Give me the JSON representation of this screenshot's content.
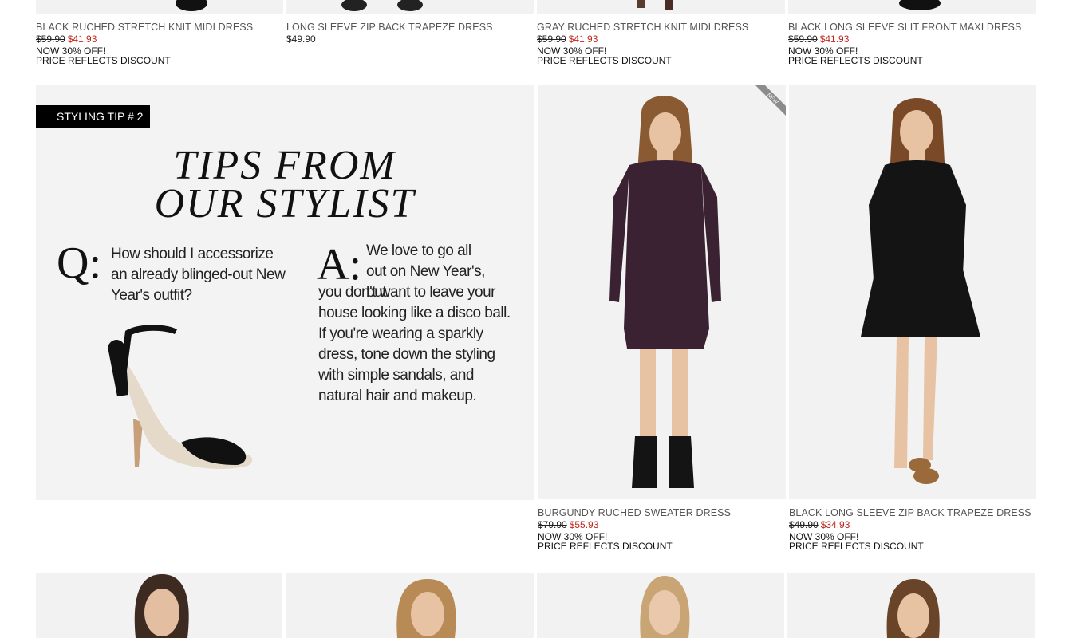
{
  "top_row": [
    {
      "name": "BLACK RUCHED STRETCH KNIT MIDI DRESS",
      "old_price": "$59.90",
      "new_price": "$41.93",
      "promo1": "NOW 30% OFF!",
      "promo2": "PRICE REFLECTS DISCOUNT"
    },
    {
      "name": "LONG SLEEVE ZIP BACK TRAPEZE DRESS",
      "price": "$49.90"
    },
    {
      "name": "GRAY RUCHED STRETCH KNIT MIDI DRESS",
      "old_price": "$59.90",
      "new_price": "$41.93",
      "promo1": "NOW 30% OFF!",
      "promo2": "PRICE REFLECTS DISCOUNT"
    },
    {
      "name": "BLACK LONG SLEEVE SLIT FRONT MAXI DRESS",
      "old_price": "$59.90",
      "new_price": "$41.93",
      "promo1": "NOW 30% OFF!",
      "promo2": "PRICE REFLECTS DISCOUNT"
    }
  ],
  "tip": {
    "label": "STYLING TIP # 2",
    "title_line1": "TIPS FROM",
    "title_line2": "OUR STYLIST",
    "q_mark": "Q:",
    "question": "How should I accessorize an already blinged-out New Year's outfit?",
    "a_mark": "A:",
    "answer_lead": "We love to go all out on New Year's, but",
    "answer_rest": "you don't want to leave your house looking like a disco ball. If you're wearing a sparkly dress, tone down the styling with simple sandals, and natural hair and makeup."
  },
  "middle_row": [
    {
      "badge": "NEW",
      "name": "BURGUNDY RUCHED SWEATER DRESS",
      "old_price": "$79.90",
      "new_price": "$55.93",
      "promo1": "NOW 30% OFF!",
      "promo2": "PRICE REFLECTS DISCOUNT"
    },
    {
      "name": "BLACK LONG SLEEVE ZIP BACK TRAPEZE DRESS",
      "old_price": "$49.90",
      "new_price": "$34.93",
      "promo1": "NOW 30% OFF!",
      "promo2": "PRICE REFLECTS DISCOUNT"
    }
  ],
  "colors": {
    "sale_red": "#c0281e",
    "image_bg": "#f2f2f2",
    "burgundy_dress": "#3a2233",
    "black_dress": "#141414"
  }
}
